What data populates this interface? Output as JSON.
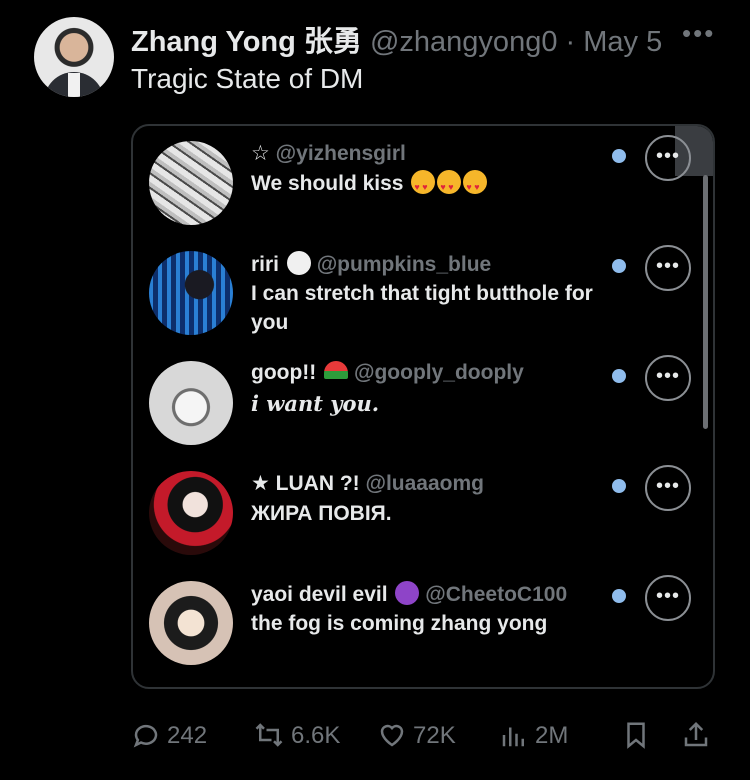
{
  "tweet": {
    "author_name": "Zhang Yong 张勇",
    "handle": "@zhangyong0",
    "separator": "·",
    "date": "May 5",
    "text": "Tragic State of DM"
  },
  "dms": [
    {
      "name": "☆",
      "handle": "@yizhensgirl",
      "message": "We should kiss",
      "emoji": "heart-eyes-emoji"
    },
    {
      "name": "riri",
      "handle": "@pumpkins_blue",
      "message": "I can stretch that tight butthole for you",
      "emoji": "thought-cloud-emoji"
    },
    {
      "name": "goop!!",
      "handle": "@gooply_dooply",
      "message": "i want you.",
      "emoji": "watermelon-emoji"
    },
    {
      "name": "★ LUAN ?!",
      "handle": "@luaaaomg",
      "message": "ЖИРА ПОВІЯ."
    },
    {
      "name": "yaoi devil evil",
      "handle": "@CheetoC100",
      "message": "the fog is coming zhang yong",
      "emoji": "devil-emoji"
    }
  ],
  "actions": {
    "replies": "242",
    "retweets": "6.6K",
    "likes": "72K",
    "views": "2M"
  },
  "colors": {
    "unread_dot": "#8fbcec",
    "muted": "#71767b",
    "text": "#e7e9ea"
  }
}
